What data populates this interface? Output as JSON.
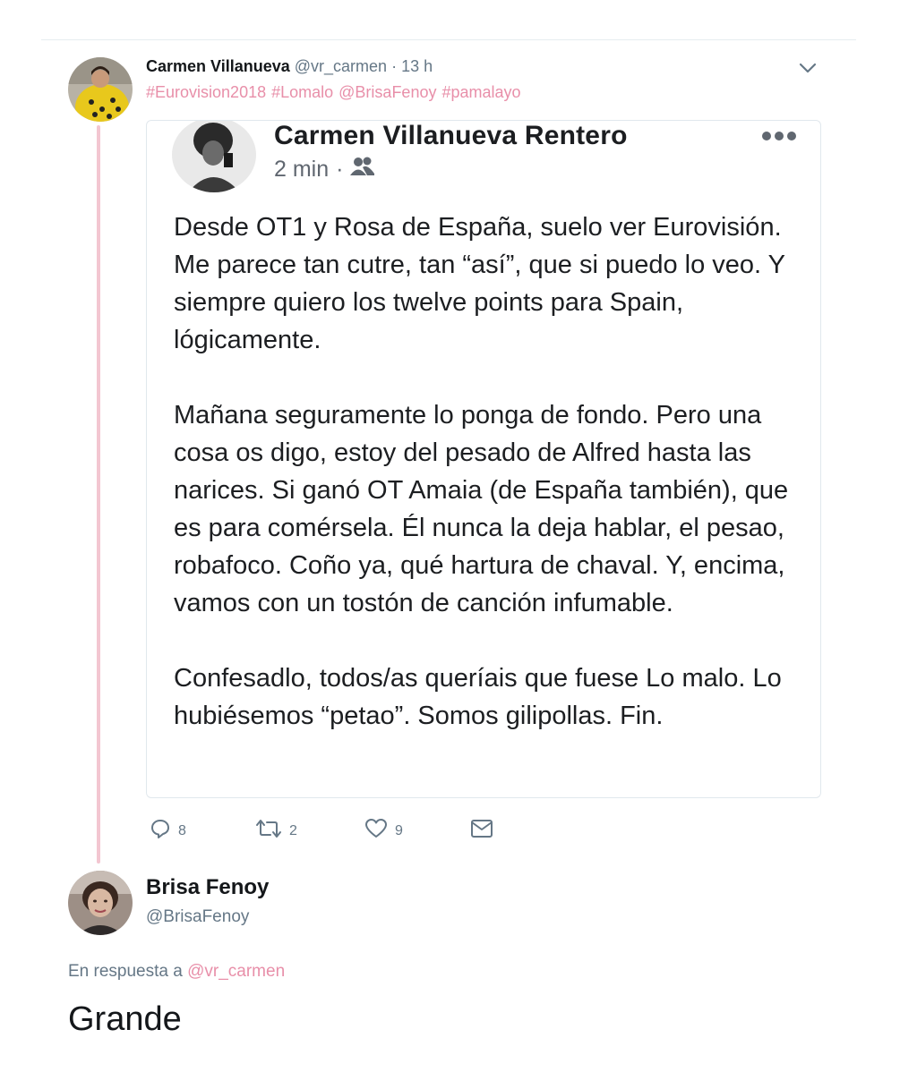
{
  "tweet": {
    "author_name": "Carmen Villanueva",
    "author_handle": "@vr_carmen",
    "separator": "·",
    "time": "13 h",
    "hashtags": [
      "#Eurovision2018",
      "#Lomalo",
      "@BrisaFenoy",
      "#pamalayo"
    ],
    "avatar_icon": "profile-photo-icon",
    "menu_icon": "chevron-down-icon"
  },
  "card": {
    "name": "Carmen Villanueva Rentero",
    "time": "2 min",
    "separator": "·",
    "audience_icon": "friends-icon",
    "more_icon": "more-dots-icon",
    "paragraphs": [
      "Desde OT1 y Rosa de España, suelo ver Eurovisión. Me parece tan cutre, tan “así”, que si puedo lo veo. Y siempre quiero los twelve points para Spain, lógicamente.",
      "Mañana seguramente lo ponga de fondo. Pero una cosa os digo, estoy del pesado de Alfred hasta las narices. Si ganó OT Amaia (de España también), que es para comérsela. Él nunca la deja hablar, el pesao, robafoco. Coño ya, qué hartura de chaval. Y, encima, vamos con un tostón de canción infumable.",
      "Confesadlo, todos/as queríais que fuese Lo malo. Lo hubiésemos “petao”. Somos gilipollas. Fin."
    ]
  },
  "actions": {
    "reply_count": "8",
    "retweet_count": "2",
    "like_count": "9",
    "reply_icon": "reply-icon",
    "retweet_icon": "retweet-icon",
    "like_icon": "heart-icon",
    "dm_icon": "envelope-icon"
  },
  "reply": {
    "author_name": "Brisa Fenoy",
    "author_handle": "@BrisaFenoy",
    "in_reply_prefix": "En respuesta a",
    "in_reply_handle": "@vr_carmen",
    "text": "Grande"
  },
  "colors": {
    "accent_pink": "#e88fa9",
    "thread_line": "#f3c6d1",
    "muted": "#657786",
    "text": "#14171a"
  }
}
